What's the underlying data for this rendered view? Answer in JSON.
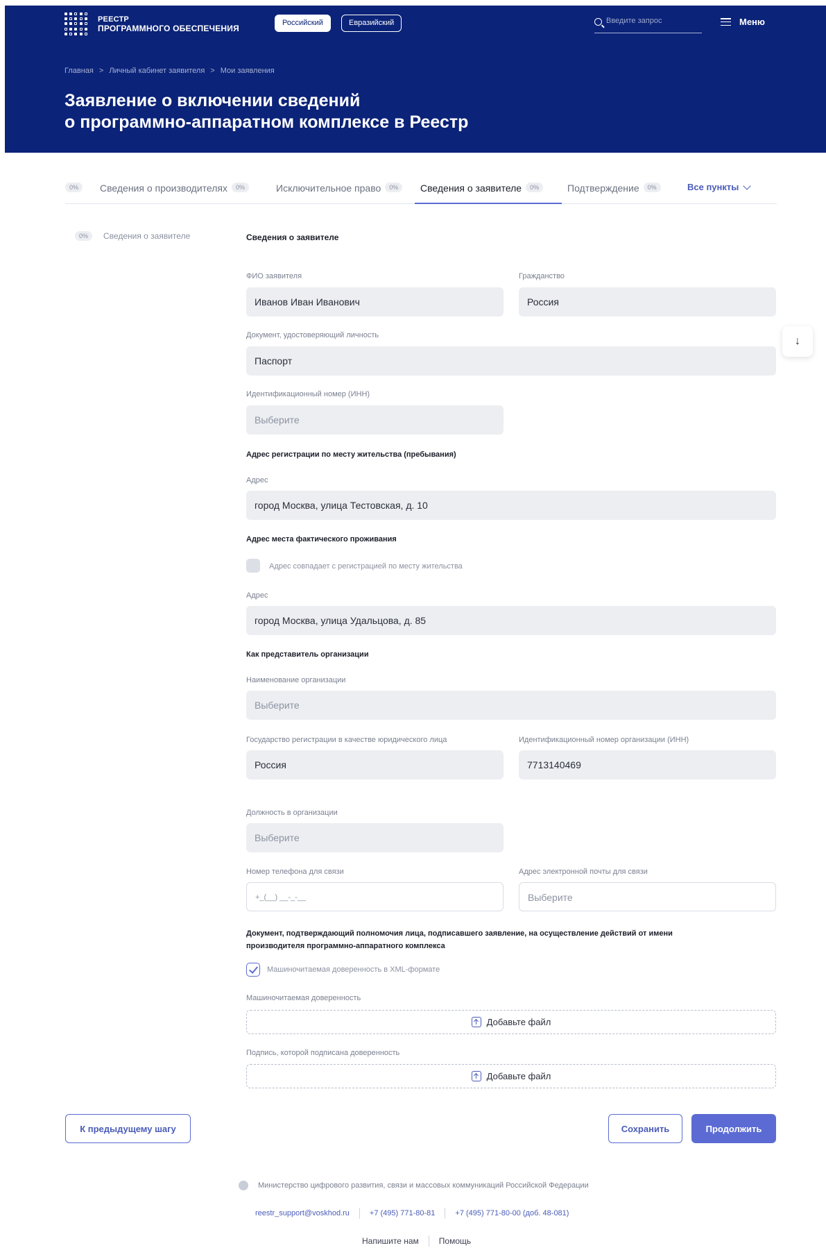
{
  "header": {
    "logo_line1": "РЕЕСТР",
    "logo_line2": "ПРОГРАММНОГО ОБЕСПЕЧЕНИЯ",
    "toggle_ru": "Российский",
    "toggle_eu": "Евразийский",
    "search_placeholder": "Введите запрос",
    "menu_label": "Меню",
    "breadcrumbs": [
      "Главная",
      "Личный кабинет заявителя",
      "Мои заявления"
    ],
    "breadcrumb_sep": ">",
    "title_line1": "Заявление о включении сведений",
    "title_line2": "о программно-аппаратном комплексе в Реестр"
  },
  "tabs": {
    "items": [
      {
        "label": "Сведения о производителях",
        "pct": "0%"
      },
      {
        "label": "Исключительное право",
        "pct": "0%"
      },
      {
        "label": "Сведения о заявителе",
        "pct": "0%"
      },
      {
        "label": "Подтверждение",
        "pct": "0%"
      }
    ],
    "first_pct": "0%",
    "all_label": "Все пункты"
  },
  "sidebar": {
    "pct": "0%",
    "label": "Сведения о заявителе"
  },
  "form": {
    "section_title": "Сведения о заявителе",
    "fio_label": "ФИО заявителя",
    "fio_value": "Иванов Иван Иванович",
    "citizenship_label": "Гражданство",
    "citizenship_value": "Россия",
    "id_doc_label": "Документ, удостоверяющий личность",
    "id_doc_value": "Паспорт",
    "inn_label": "Идентификационный номер (ИНН)",
    "inn_placeholder": "Выберите",
    "reg_address_title": "Адрес регистрации по месту жительства (пребывания)",
    "reg_address_label": "Адрес",
    "reg_address_value": "город Москва, улица Тестовская, д. 10",
    "fact_address_title": "Адрес места фактического проживания",
    "same_address_label": "Адрес совпадает с регистрацией по месту жительства",
    "fact_address_label": "Адрес",
    "fact_address_value": "город Москва, улица Удальцова, д. 85",
    "org_rep_title": "Как представитель организации",
    "org_name_label": "Наименование организации",
    "org_name_placeholder": "Выберите",
    "reg_state_label": "Государство регистрации в качестве юридического лица",
    "reg_state_value": "Россия",
    "org_inn_label": "Идентификационный номер организации (ИНН)",
    "org_inn_value": "7713140469",
    "position_label": "Должность в организации",
    "position_placeholder": "Выберите",
    "phone_label": "Номер телефона для связи",
    "phone_placeholder": "+_(__) __-_-__",
    "email_label": "Адрес электронной почты для связи",
    "email_placeholder": "Выберите",
    "authority_title_line1": "Документ, подтверждающий полномочия лица, подписавшего заявление, на осуществление действий от имени",
    "authority_title_line2": "производителя программно-аппаратного комплекса",
    "xml_checkbox_label": "Машиночитаемая доверенность в XML-формате",
    "poa_label": "Машиночитаемая доверенность",
    "poa_upload": "Добавьте файл",
    "signature_label": "Подпись, которой подписана доверенность",
    "signature_upload": "Добавьте файл"
  },
  "actions": {
    "prev": "К предыдущему шагу",
    "save": "Сохранить",
    "continue": "Продолжить"
  },
  "footer": {
    "ministry": "Министерство цифрового развития, связи и массовых коммуникаций Российской Федерации",
    "email": "reestr_support@voskhod.ru",
    "phone1": "+7 (495) 771-80-81",
    "phone2": "+7 (495) 771-80-00 (доб. 48-081)",
    "write_us": "Напишите нам",
    "help": "Помощь"
  },
  "colors": {
    "header_bg": "#0b2378",
    "accent": "#5b6bd3"
  }
}
